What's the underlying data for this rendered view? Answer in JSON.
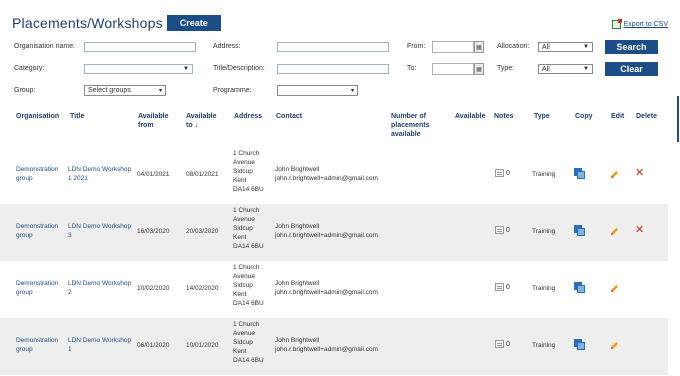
{
  "header": {
    "title": "Placements/Workshops",
    "create_label": "Create",
    "export_label": "Export to CSV"
  },
  "filters": {
    "organisation_label": "Organisation name:",
    "organisation_value": "",
    "category_label": "Category:",
    "category_value": "",
    "group_label": "Group:",
    "group_value": "Select groups",
    "address_label": "Address:",
    "address_value": "",
    "title_label": "Title/Description:",
    "title_value": "",
    "programme_label": "Programme:",
    "programme_value": "",
    "from_label": "From:",
    "from_value": "",
    "to_label": "To:",
    "to_value": "",
    "allocation_label": "Allocation:",
    "allocation_value": "All",
    "type_label": "Type:",
    "type_value": "All",
    "search_label": "Search",
    "clear_label": "Clear"
  },
  "columns": {
    "organisation": "Organisation",
    "title": "Title",
    "available_from_1": "Available",
    "available_from_2": "from",
    "available_to_1": "Available",
    "available_to_2": "to",
    "address": "Address",
    "contact": "Contact",
    "number_1": "Number of",
    "number_2": "placements",
    "number_3": "available",
    "available": "Available",
    "notes": "Notes",
    "type": "Type",
    "copy": "Copy",
    "edit": "Edit",
    "delete": "Delete"
  },
  "rows": [
    {
      "org_1": "Demonstration",
      "org_2": "group",
      "title_1": "LDN Demo Workshop",
      "title_2": "1 2021",
      "from": "04/01/2021",
      "to": "08/01/2021",
      "addr_1": "1 Church",
      "addr_2": "Avenue",
      "addr_3": "Sidcup",
      "addr_4": "Kent",
      "addr_5": "DA14 6BU",
      "contact_name": "John Brightwell",
      "contact_email": "john.r.brightwell+admin@gmail.com",
      "notes_count": "0",
      "type": "Training",
      "deletable": true
    },
    {
      "org_1": "Demonstration",
      "org_2": "group",
      "title_1": "LDN Demo Workshop",
      "title_2": "3",
      "from": "16/03/2020",
      "to": "20/03/2020",
      "addr_1": "1 Church",
      "addr_2": "Avenue",
      "addr_3": "Sidcup",
      "addr_4": "Kent",
      "addr_5": "DA14 6BU",
      "contact_name": "John Brightwell",
      "contact_email": "john.r.brightwell+admin@gmail.com",
      "notes_count": "0",
      "type": "Training",
      "deletable": true
    },
    {
      "org_1": "Demonstration",
      "org_2": "group",
      "title_1": "LDN Demo Workshop",
      "title_2": "2",
      "from": "10/02/2020",
      "to": "14/02/2020",
      "addr_1": "1 Church",
      "addr_2": "Avenue",
      "addr_3": "Sidcup",
      "addr_4": "Kent",
      "addr_5": "DA14 6BU",
      "contact_name": "John Brightwell",
      "contact_email": "john.r.brightwell+admin@gmail.com",
      "notes_count": "0",
      "type": "Training",
      "deletable": false
    },
    {
      "org_1": "Demonstration",
      "org_2": "group",
      "title_1": "LDN Demo Workshop",
      "title_2": "1",
      "from": "06/01/2020",
      "to": "10/01/2020",
      "addr_1": "1 Church",
      "addr_2": "Avenue",
      "addr_3": "Sidcup",
      "addr_4": "Kent",
      "addr_5": "DA14 6BU",
      "contact_name": "John Brightwell",
      "contact_email": "john.r.brightwell+admin@gmail.com",
      "notes_count": "0",
      "type": "Training",
      "deletable": false
    }
  ],
  "icons": {
    "export": "csv-export-icon",
    "calendar": "calendar-icon",
    "notes": "notes-icon",
    "copy": "copy-icon",
    "edit": "pencil-icon",
    "delete": "delete-x-icon"
  },
  "colors": {
    "primary": "#1d4d86",
    "title": "#1f3f6b",
    "delete": "#d0281b",
    "edit": "#e8a020",
    "row_alt": "#eeeeee"
  }
}
